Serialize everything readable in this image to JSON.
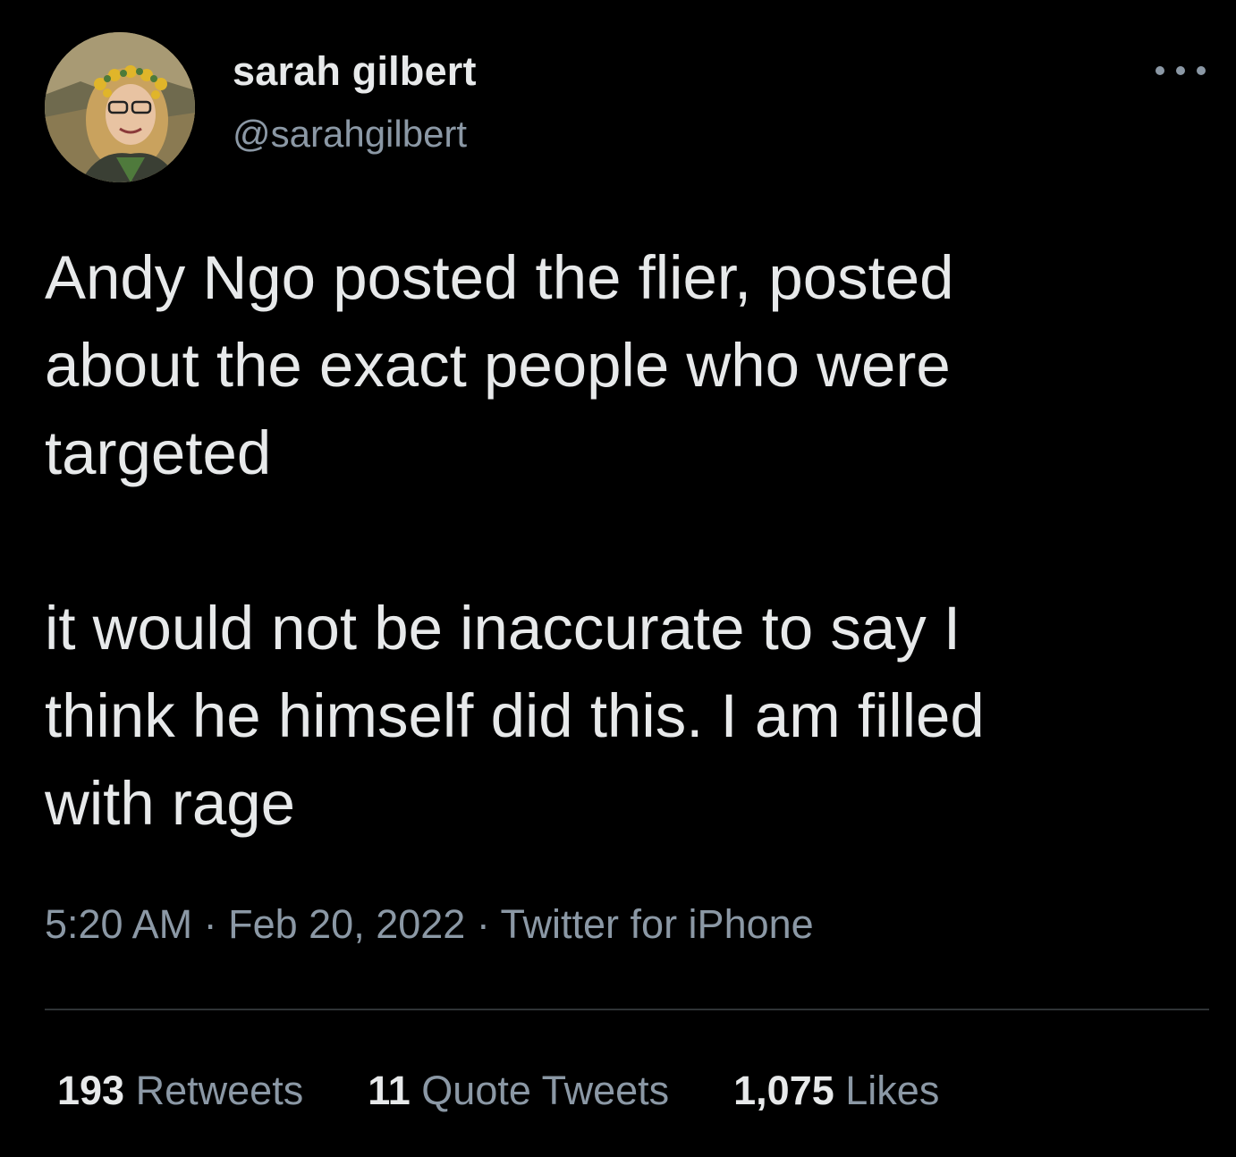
{
  "author": {
    "display_name": "sarah gilbert",
    "handle": "@sarahgilbert"
  },
  "tweet": {
    "text": "Andy Ngo posted the flier, posted\nabout the exact people who were\ntargeted\n\nit would not be inaccurate to say I\nthink he himself did this. I am filled\nwith rage",
    "time": "5:20 AM",
    "date": "Feb 20, 2022",
    "source": "Twitter for iPhone",
    "separator": " · "
  },
  "stats": {
    "retweets_count": "193",
    "retweets_label": "Retweets",
    "quotes_count": "11",
    "quotes_label": "Quote Tweets",
    "likes_count": "1,075",
    "likes_label": "Likes"
  },
  "icons": {
    "more": "more-horizontal-icon"
  },
  "colors": {
    "background": "#000000",
    "primary_text": "#e7e9ea",
    "secondary_text": "#8b98a5",
    "divider": "#2f3336"
  }
}
